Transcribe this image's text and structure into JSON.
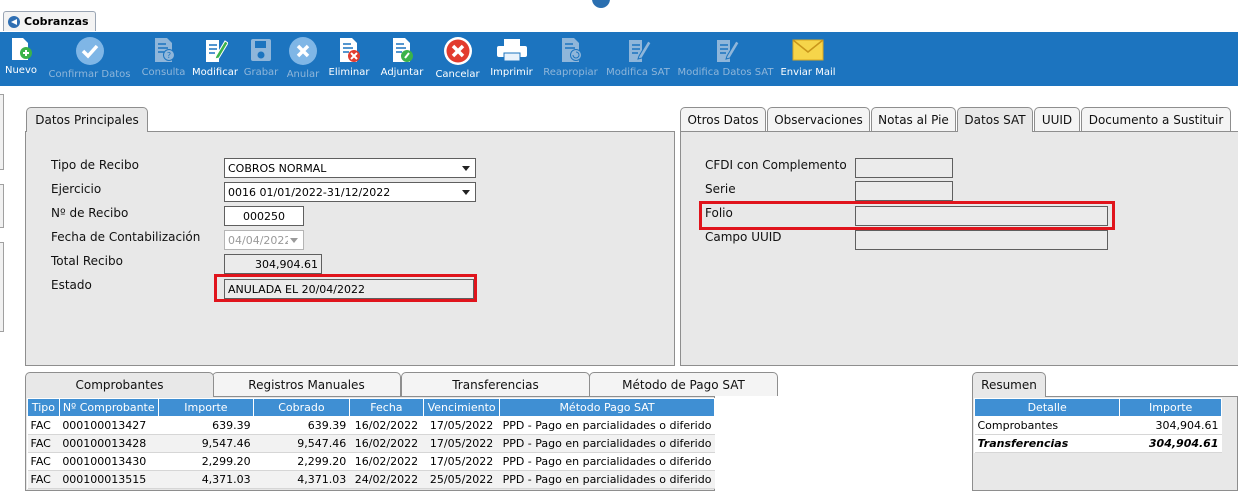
{
  "window": {
    "tab_title": "Cobranzas"
  },
  "toolbar": [
    {
      "label": "Nuevo",
      "icon": "new-doc-icon",
      "enabled": true
    },
    {
      "label": "Confirmar Datos",
      "icon": "check-icon",
      "enabled": false
    },
    {
      "label": "Consulta",
      "icon": "query-doc-icon",
      "enabled": false
    },
    {
      "label": "Modificar",
      "icon": "edit-icon",
      "enabled": true
    },
    {
      "label": "Grabar",
      "icon": "save-icon",
      "enabled": false
    },
    {
      "label": "Anular",
      "icon": "cancel-x-icon",
      "enabled": false
    },
    {
      "label": "Eliminar",
      "icon": "delete-doc-icon",
      "enabled": true
    },
    {
      "label": "Adjuntar",
      "icon": "attach-icon",
      "enabled": true
    },
    {
      "label": "Cancelar",
      "icon": "cancel-red-icon",
      "enabled": true
    },
    {
      "label": "Imprimir",
      "icon": "printer-icon",
      "enabled": true
    },
    {
      "label": "Reapropiar",
      "icon": "reassign-icon",
      "enabled": false
    },
    {
      "label": "Modifica SAT",
      "icon": "edit-sat-icon",
      "enabled": false
    },
    {
      "label": "Modifica Datos SAT",
      "icon": "edit-sat-data-icon",
      "enabled": false
    },
    {
      "label": "Enviar Mail",
      "icon": "mail-icon",
      "enabled": true
    }
  ],
  "datos_principales": {
    "tab_label": "Datos Principales",
    "tipo_recibo": {
      "label": "Tipo de Recibo",
      "value": "COBROS NORMAL"
    },
    "ejercicio": {
      "label": "Ejercicio",
      "value": "0016 01/01/2022-31/12/2022"
    },
    "numero_recibo": {
      "label": "Nº de Recibo",
      "value": "000250"
    },
    "fecha_contabilizacion": {
      "label": "Fecha de Contabilización",
      "value": "04/04/2022"
    },
    "total_recibo": {
      "label": "Total Recibo",
      "value": "304,904.61"
    },
    "estado": {
      "label": "Estado",
      "value": "ANULADA EL 20/04/2022"
    }
  },
  "sat_tabs": [
    "Otros Datos",
    "Observaciones",
    "Notas al Pie",
    "Datos SAT",
    "UUID",
    "Documento a Sustituir"
  ],
  "datos_sat": {
    "cfdi": {
      "label": "CFDI con Complemento",
      "value": ""
    },
    "serie": {
      "label": "Serie",
      "value": ""
    },
    "folio": {
      "label": "Folio",
      "value": ""
    },
    "uuid": {
      "label": "Campo UUID",
      "value": ""
    }
  },
  "bottom_tabs": [
    "Comprobantes",
    "Registros Manuales",
    "Transferencias",
    "Método de Pago SAT"
  ],
  "comprobantes": {
    "columns": [
      "Tipo",
      "Nº Comprobante",
      "Importe",
      "Cobrado",
      "Fecha",
      "Vencimiento",
      "Método Pago SAT"
    ],
    "rows": [
      [
        "FAC",
        "000100013427",
        "639.39",
        "639.39",
        "16/02/2022",
        "17/05/2022",
        "PPD - Pago en parcialidades o diferido"
      ],
      [
        "FAC",
        "000100013428",
        "9,547.46",
        "9,547.46",
        "16/02/2022",
        "17/05/2022",
        "PPD - Pago en parcialidades o diferido"
      ],
      [
        "FAC",
        "000100013430",
        "2,299.20",
        "2,299.20",
        "16/02/2022",
        "17/05/2022",
        "PPD - Pago en parcialidades o diferido"
      ],
      [
        "FAC",
        "000100013515",
        "4,371.03",
        "4,371.03",
        "24/02/2022",
        "25/05/2022",
        "PPD - Pago en parcialidades o diferido"
      ]
    ]
  },
  "resumen": {
    "tab_label": "Resumen",
    "columns": [
      "Detalle",
      "Importe"
    ],
    "rows": [
      [
        "Comprobantes",
        "304,904.61"
      ],
      [
        "Transferencias",
        "304,904.61"
      ]
    ]
  },
  "colors": {
    "toolbar": "#1c74bf",
    "header": "#3f8fd3",
    "highlight": "#e0141c"
  }
}
